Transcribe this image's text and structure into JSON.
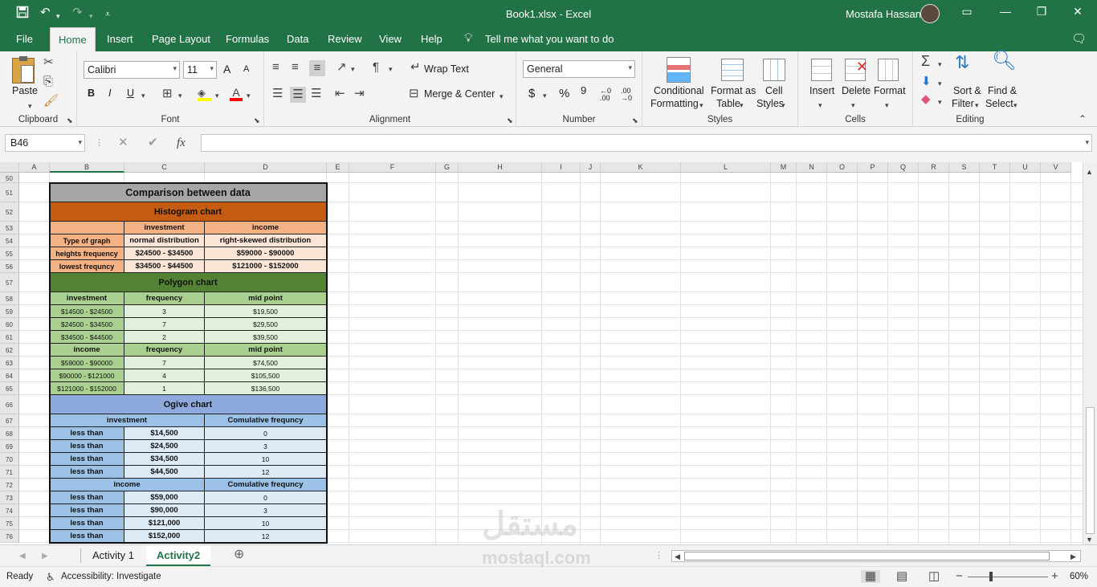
{
  "app": {
    "window_title": "Book1.xlsx  -  Excel",
    "user_name": "Mostafa Hassan"
  },
  "quick_access": {
    "save_icon": "save-icon",
    "undo_icon": "undo-icon",
    "redo_icon": "redo-icon",
    "customize_icon": "customize-icon"
  },
  "window_buttons": {
    "restore_ribbon": "▭",
    "minimize": "—",
    "maximize": "❐",
    "close": "✕"
  },
  "ribbon_tabs": [
    "File",
    "Home",
    "Insert",
    "Page Layout",
    "Formulas",
    "Data",
    "Review",
    "View",
    "Help"
  ],
  "tell_me": "Tell me what you want to do",
  "groups": {
    "clipboard": "Clipboard",
    "font": "Font",
    "alignment": "Alignment",
    "number": "Number",
    "styles": "Styles",
    "cells": "Cells",
    "editing": "Editing"
  },
  "clipboard": {
    "paste": "Paste"
  },
  "font": {
    "name": "Calibri",
    "size": "11",
    "bold": "B",
    "italic": "I",
    "underline": "U",
    "grow": "A",
    "shrink": "A"
  },
  "alignment": {
    "wrap_text": "Wrap Text",
    "merge_center": "Merge & Center"
  },
  "number": {
    "format": "General",
    "currency": "$",
    "percent": "%",
    "comma": "9",
    "inc_dec": "←0 .00",
    "dec_dec": ".00 →0"
  },
  "styles": {
    "conditional_1": "Conditional",
    "conditional_2": "Formatting",
    "format_table_1": "Format as",
    "format_table_2": "Table",
    "cell_styles_1": "Cell",
    "cell_styles_2": "Styles"
  },
  "cells": {
    "insert": "Insert",
    "delete": "Delete",
    "format": "Format"
  },
  "editing": {
    "sort_1": "Sort &",
    "sort_2": "Filter",
    "find_1": "Find &",
    "find_2": "Select"
  },
  "formula_bar": {
    "name_box": "B46",
    "fx": "fx",
    "cancel": "✕",
    "enter": "✔",
    "value": ""
  },
  "columns": [
    "A",
    "B",
    "C",
    "D",
    "E",
    "F",
    "G",
    "H",
    "I",
    "J",
    "K",
    "L",
    "M",
    "N",
    "O",
    "P",
    "Q",
    "R",
    "S",
    "T",
    "U",
    "V"
  ],
  "rows": [
    "50",
    "51",
    "52",
    "53",
    "54",
    "55",
    "56",
    "57",
    "58",
    "59",
    "60",
    "61",
    "62",
    "63",
    "64",
    "65",
    "66",
    "67",
    "68",
    "69",
    "70",
    "71",
    "72",
    "73",
    "74",
    "75",
    "76"
  ],
  "sheet": {
    "title": "Comparison between data",
    "histogram": {
      "header": "Histogram chart",
      "col_investment": "investment",
      "col_income": "income",
      "rows": [
        {
          "label": "Type of graph",
          "investment": "normal distribution",
          "income": "right-skewed distribution"
        },
        {
          "label": "heights frequency",
          "investment": "$24500 - $34500",
          "income": "$59000 - $90000"
        },
        {
          "label": "lowest frequncy",
          "investment": "$34500 - $44500",
          "income": "$121000 - $152000"
        }
      ]
    },
    "polygon": {
      "header": "Polygon chart",
      "inv_head": [
        "investment",
        "frequency",
        "mid point"
      ],
      "inv_rows": [
        [
          "$14500 - $24500",
          "3",
          "$19,500"
        ],
        [
          "$24500 - $34500",
          "7",
          "$29,500"
        ],
        [
          "$34500 - $44500",
          "2",
          "$39,500"
        ]
      ],
      "inc_head": [
        "income",
        "frequency",
        "mid point"
      ],
      "inc_rows": [
        [
          "$59000 - $90000",
          "7",
          "$74,500"
        ],
        [
          "$90000 - $121000",
          "4",
          "$105,500"
        ],
        [
          "$121000 - $152000",
          "1",
          "$136,500"
        ]
      ]
    },
    "ogive": {
      "header": "Ogive chart",
      "inv_head": "investment",
      "cum_head": "Comulative frequncy",
      "inv_rows": [
        [
          "less than",
          "$14,500",
          "0"
        ],
        [
          "less than",
          "$24,500",
          "3"
        ],
        [
          "less than",
          "$34,500",
          "10"
        ],
        [
          "less than",
          "$44,500",
          "12"
        ]
      ],
      "inc_head": "income",
      "inc_rows": [
        [
          "less than",
          "$59,000",
          "0"
        ],
        [
          "less than",
          "$90,000",
          "3"
        ],
        [
          "less than",
          "$121,000",
          "10"
        ],
        [
          "less than",
          "$152,000",
          "12"
        ]
      ]
    }
  },
  "sheet_tabs": [
    "Activity 1",
    "Activity2"
  ],
  "status": {
    "ready": "Ready",
    "accessibility": "Accessibility: Investigate",
    "zoom": "60%"
  },
  "watermark": {
    "arabic": "مستقل",
    "latin": "mostaql.com"
  },
  "colors": {
    "excel_green": "#217346",
    "gray_header": "#a6a6a6",
    "orange_header": "#c55a11",
    "orange_light": "#f4b183",
    "orange_pale": "#fbe5d6",
    "green_header": "#548235",
    "green_light": "#a9d08e",
    "green_pale": "#e2efda",
    "blue_header": "#8ea9db",
    "blue_light": "#9bc2e6",
    "blue_pale": "#ddebf7"
  }
}
